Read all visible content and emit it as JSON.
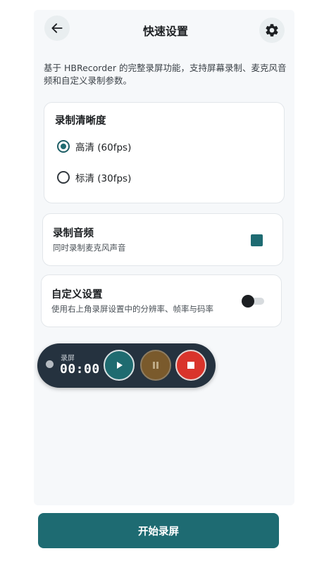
{
  "header": {
    "title": "快速设置",
    "back_icon": "arrow-left-icon",
    "settings_icon": "gear-icon"
  },
  "description": "基于 HBRecorder 的完整录屏功能，支持屏幕录制、麦克风音频和自定义录制参数。",
  "quality": {
    "title": "录制清晰度",
    "options": [
      {
        "label": "高清 (60fps)",
        "selected": true
      },
      {
        "label": "标清 (30fps)",
        "selected": false
      }
    ]
  },
  "audio": {
    "title": "录制音频",
    "subtitle": "同时录制麦克风声音",
    "checked": true
  },
  "custom": {
    "title": "自定义设置",
    "subtitle": "使用右上角录屏设置中的分辨率、帧率与码率",
    "enabled": false
  },
  "floating_recorder": {
    "label": "录屏",
    "timer": "00:00",
    "icons": [
      "play-icon",
      "pause-icon",
      "stop-icon"
    ]
  },
  "start_button": {
    "label": "开始录屏"
  },
  "colors": {
    "accent": "#1e6b72",
    "stop": "#d9342b",
    "pause": "#7a5a2c",
    "float_bg": "#25323f"
  }
}
